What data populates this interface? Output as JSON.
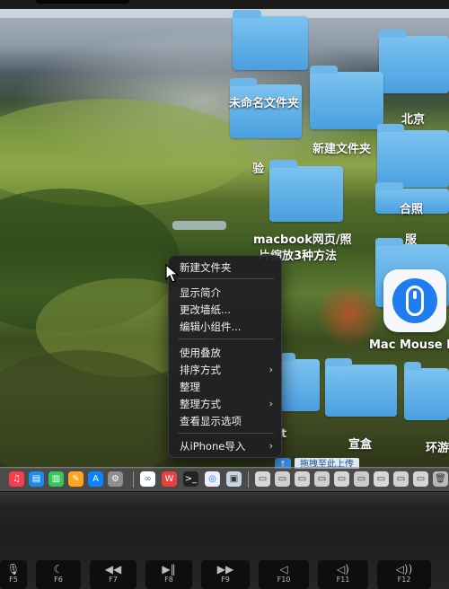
{
  "desktop": {
    "folders": [
      {
        "label": "未命名文件夹"
      },
      {
        "label": "新建文件夹"
      },
      {
        "label": "北京"
      },
      {
        "label": "合照"
      },
      {
        "label": "服"
      },
      {
        "label": "验"
      },
      {
        "label": "macbook网页/照"
      },
      {
        "label": "片缩放3种方法"
      },
      {
        "label": "宣盒"
      },
      {
        "label": "环游"
      },
      {
        "label": "t"
      }
    ],
    "app": {
      "label": "Mac Mouse F"
    }
  },
  "context_menu": {
    "items": [
      {
        "label": "新建文件夹"
      },
      {
        "label": "显示简介"
      },
      {
        "label": "更改墙纸..."
      },
      {
        "label": "编辑小组件..."
      },
      {
        "label": "使用叠放"
      },
      {
        "label": "排序方式"
      },
      {
        "label": "整理"
      },
      {
        "label": "整理方式"
      },
      {
        "label": "查看显示选项"
      },
      {
        "label": "从iPhone导入"
      }
    ],
    "submenu_arrow": "›"
  },
  "upload_bar": {
    "label": "拖拽至此上传",
    "icon": "upload-icon"
  },
  "keyboard": {
    "keys": [
      {
        "glyph": "🎙",
        "name": "F5"
      },
      {
        "glyph": "☾",
        "name": "F6"
      },
      {
        "glyph": "◀◀",
        "name": "F7"
      },
      {
        "glyph": "▶‖",
        "name": "F8"
      },
      {
        "glyph": "▶▶",
        "name": "F9"
      },
      {
        "glyph": "◁",
        "name": "F10"
      },
      {
        "glyph": "◁)",
        "name": "F11"
      },
      {
        "glyph": "◁))",
        "name": "F12"
      }
    ]
  }
}
